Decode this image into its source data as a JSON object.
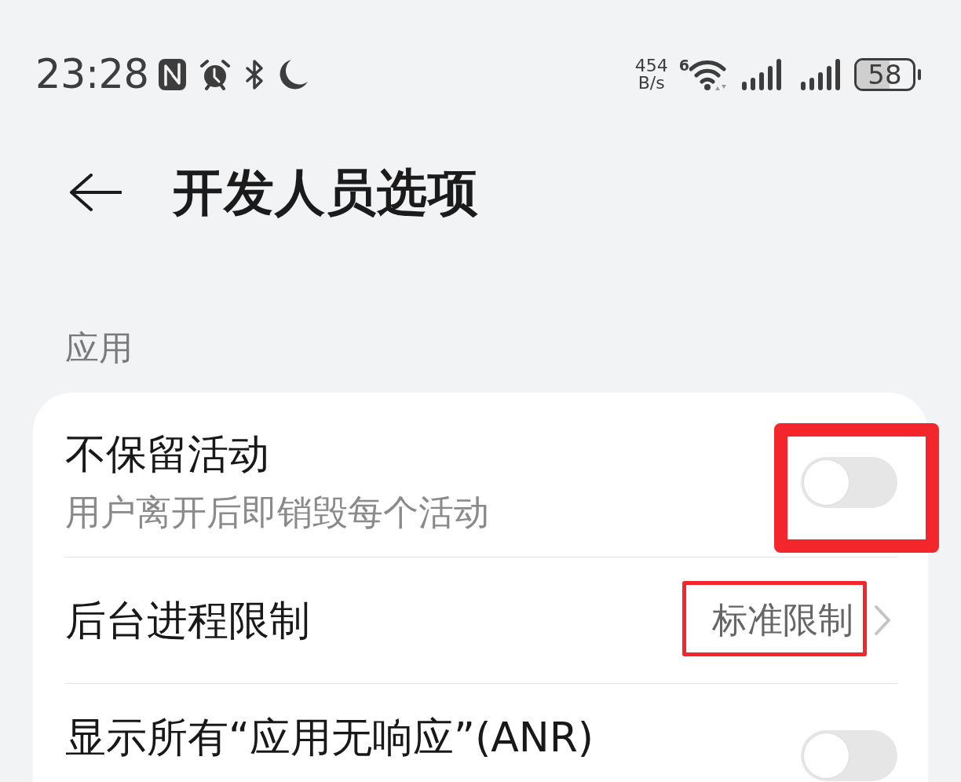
{
  "status_bar": {
    "time": "23:28",
    "net_speed": {
      "value": "454",
      "unit": "B/s"
    },
    "wifi_standard": "6",
    "battery": "58"
  },
  "header": {
    "title": "开发人员选项"
  },
  "section": {
    "label": "应用"
  },
  "settings": [
    {
      "kind": "toggle",
      "title": "不保留活动",
      "subtitle": "用户离开后即销毁每个活动",
      "on": false,
      "highlighted": true
    },
    {
      "kind": "choice",
      "title": "后台进程限制",
      "value": "标准限制",
      "highlighted": true
    },
    {
      "kind": "toggle",
      "title": "显示所有“应用无响应”(ANR)",
      "on": false,
      "highlighted": false
    }
  ]
}
